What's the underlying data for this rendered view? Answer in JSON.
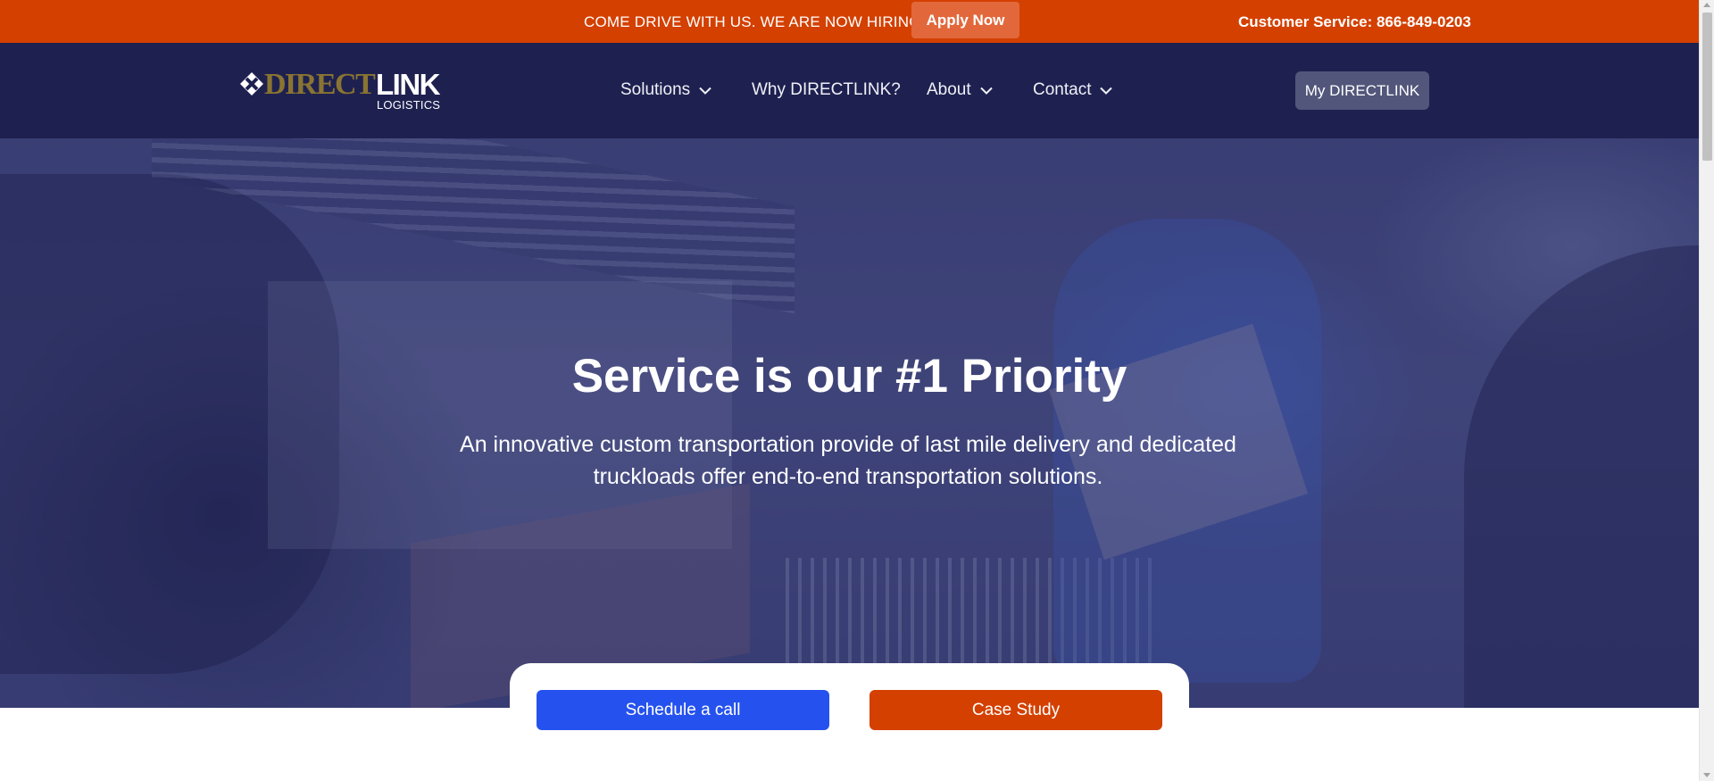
{
  "topbar": {
    "hiring_text": "COME DRIVE WITH US. WE ARE NOW HIRING!",
    "apply_label": "Apply Now",
    "customer_service": "Customer Service: 866-849-0203"
  },
  "header": {
    "logo": {
      "direct": "DIRECT",
      "link": "LINK",
      "logistics": "LOGISTICS",
      "icon": "directlink-mark-icon"
    },
    "nav": [
      {
        "label": "Solutions",
        "has_dropdown": true
      },
      {
        "label": "Why DIRECTLINK?",
        "has_dropdown": false
      },
      {
        "label": "About",
        "has_dropdown": true
      },
      {
        "label": "Contact",
        "has_dropdown": true
      }
    ],
    "account_button": "My DIRECTLINK"
  },
  "hero": {
    "title": "Service is our #1 Priority",
    "subtitle": "An innovative custom transportation provide of last mile delivery and dedicated truckloads offer end-to-end transportation solutions.",
    "background": "delivery-worker-photo"
  },
  "cta": {
    "primary_label": "Schedule a call",
    "secondary_label": "Case Study"
  },
  "colors": {
    "accent_orange": "#d44000",
    "navy": "#1e2150",
    "primary_blue": "#2552ee",
    "logo_gold": "#8a7432"
  }
}
